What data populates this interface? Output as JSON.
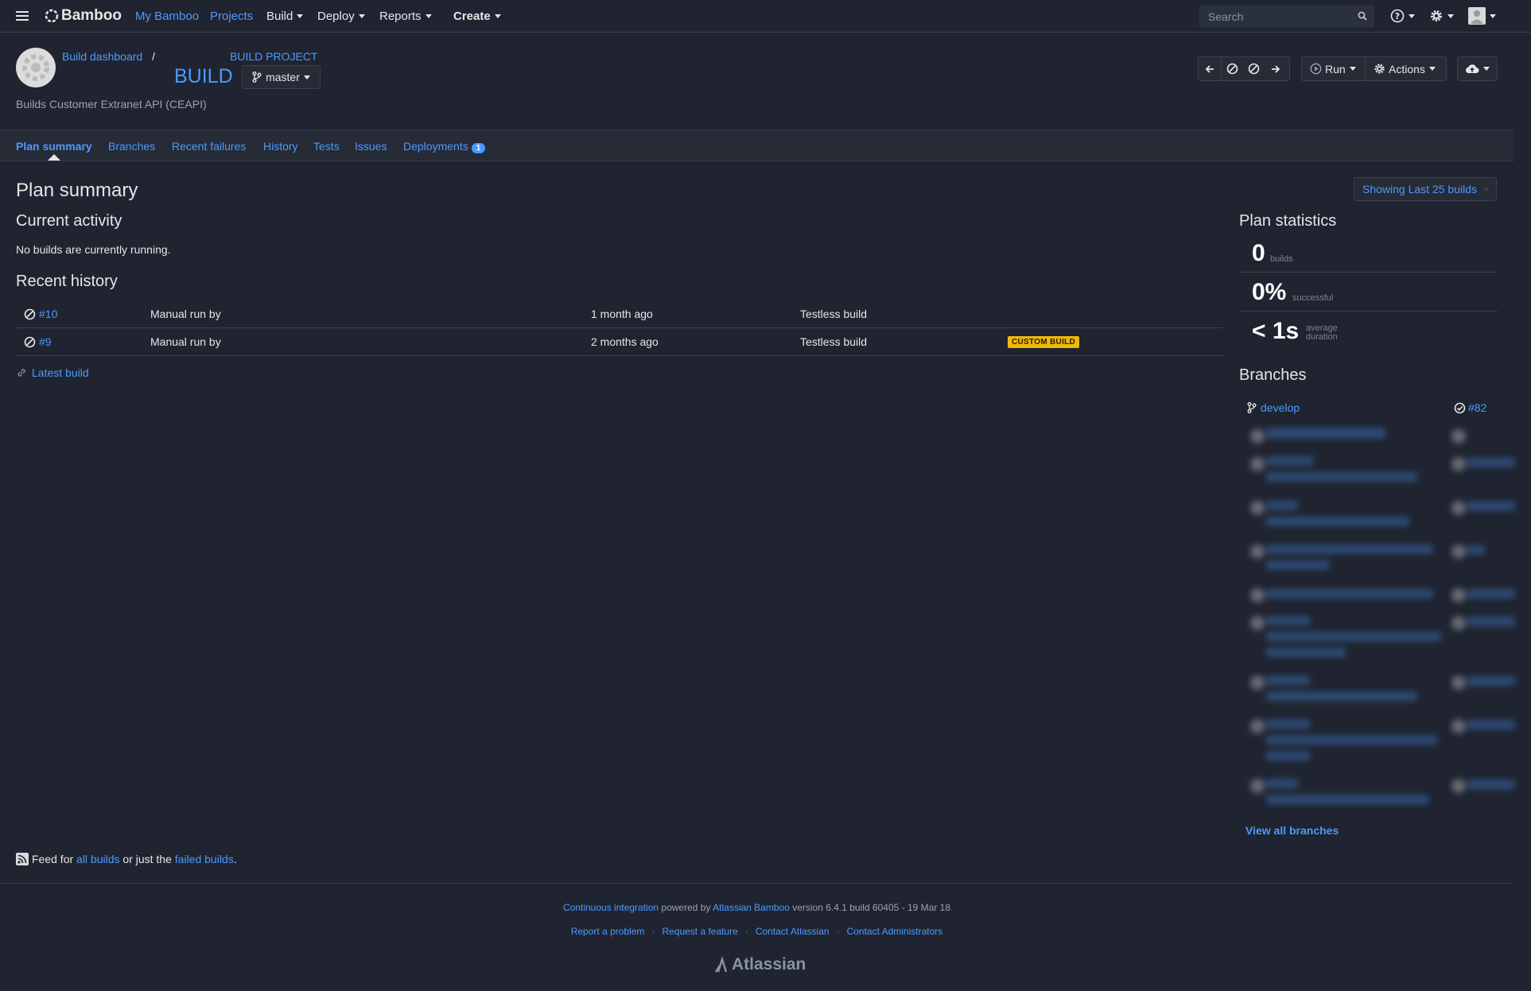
{
  "topnav": {
    "app_name": "Bamboo",
    "my_bamboo": "My Bamboo",
    "projects": "Projects",
    "build": "Build",
    "deploy": "Deploy",
    "reports": "Reports",
    "create": "Create",
    "search_placeholder": "Search"
  },
  "header": {
    "breadcrumb_dashboard": "Build dashboard",
    "breadcrumb_separator": "/",
    "project_name": "BUILD PROJECT",
    "plan_name": "BUILD",
    "branch": "master",
    "description": "Builds Customer Extranet API (CEAPI)",
    "run_label": "Run",
    "actions_label": "Actions"
  },
  "tabs": [
    {
      "label": "Plan summary",
      "active": true
    },
    {
      "label": "Branches"
    },
    {
      "label": "Recent failures"
    },
    {
      "label": "History"
    },
    {
      "label": "Tests"
    },
    {
      "label": "Issues"
    },
    {
      "label": "Deployments",
      "badge": "1"
    }
  ],
  "main": {
    "title": "Plan summary",
    "showing": "Showing Last 25 builds",
    "current_activity_title": "Current activity",
    "current_activity_text": "No builds are currently running.",
    "recent_history_title": "Recent history",
    "history": [
      {
        "build": "#10",
        "trigger": "Manual run by",
        "time": "1 month ago",
        "result": "Testless build",
        "badge": ""
      },
      {
        "build": "#9",
        "trigger": "Manual run by",
        "time": "2 months ago",
        "result": "Testless build",
        "badge": "CUSTOM BUILD"
      }
    ],
    "latest_build": "Latest build",
    "feed": {
      "prefix": "Feed for",
      "all_builds": "all builds",
      "middle": "or just the",
      "failed_builds": "failed builds",
      "suffix": "."
    }
  },
  "stats": {
    "title": "Plan statistics",
    "builds_value": "0",
    "builds_label": "builds",
    "success_value": "0%",
    "success_label": "successful",
    "duration_value": "< 1s",
    "duration_label_1": "average",
    "duration_label_2": "duration"
  },
  "branches": {
    "title": "Branches",
    "first": {
      "name": "develop",
      "build": "#82"
    },
    "view_all": "View all branches"
  },
  "footer": {
    "ci": "Continuous integration",
    "powered": "powered by",
    "bamboo": "Atlassian Bamboo",
    "version": "version 6.4.1 build 60405 - 19 Mar 18",
    "links": [
      "Report a problem",
      "Request a feature",
      "Contact Atlassian",
      "Contact Administrators"
    ],
    "logo": "Atlassian"
  },
  "colors": {
    "accent": "#4c9aff",
    "background": "#1f2430",
    "badge_custom": "#f0b90b"
  }
}
